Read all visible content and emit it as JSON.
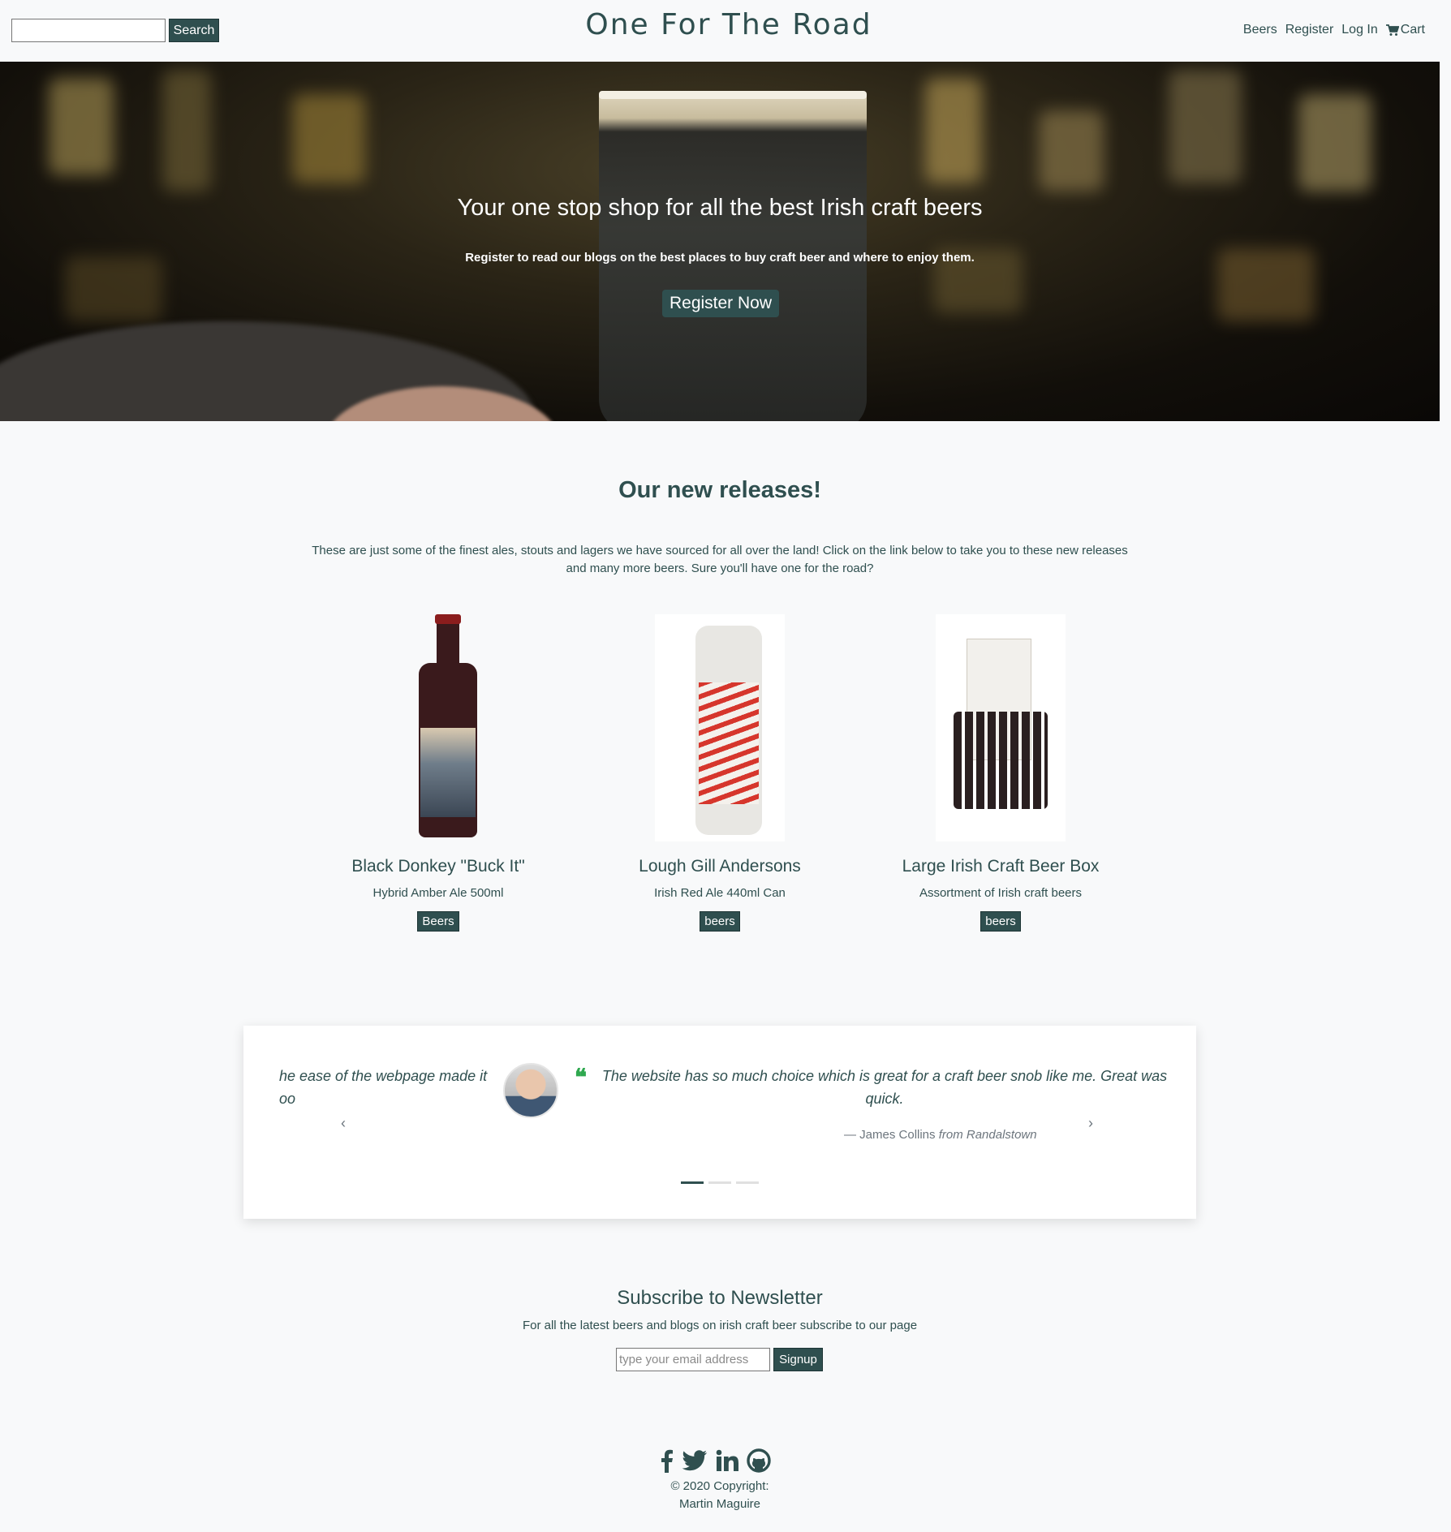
{
  "header": {
    "search_placeholder": "",
    "search_button": "Search",
    "brand": "One For The Road",
    "nav": [
      "Beers",
      "Register",
      "Log In"
    ],
    "cart_label": "Cart",
    "cart_icon": "shopping-cart-icon"
  },
  "hero": {
    "title": "Your one stop shop for all the best Irish craft beers",
    "subtitle": "Register to read our blogs on the best places to buy craft beer and where to enjoy them.",
    "button": "Register Now"
  },
  "new_releases": {
    "title": "Our new releases!",
    "description": "These are just some of the finest ales, stouts and lagers we have sourced for all over the land! Click on the link below to take you to these new releases and many more beers. Sure you'll have one for the road?",
    "products": [
      {
        "name": "Black Donkey \"Buck It\"",
        "desc": "Hybrid Amber Ale 500ml",
        "tag": "Beers"
      },
      {
        "name": "Lough Gill Andersons",
        "desc": "Irish Red Ale 440ml Can",
        "tag": "beers"
      },
      {
        "name": "Large Irish Craft Beer Box",
        "desc": "Assortment of Irish craft beers",
        "tag": "beers"
      }
    ]
  },
  "testimonials": {
    "previous_fragment": "he ease of the webpage made it oo",
    "quote_mark": "❝",
    "text": "The website has so much choice which is great for a craft beer snob like me. Great was quick.",
    "author": "— James Collins",
    "from": "from Randalstown",
    "prev_arrow": "‹",
    "next_arrow": "›",
    "slides": 3,
    "active_slide": 1
  },
  "newsletter": {
    "title": "Subscribe to Newsletter",
    "subtitle": "For all the latest beers and blogs on irish craft beer subscribe to our page",
    "placeholder": "type your email address",
    "button": "Signup"
  },
  "footer": {
    "social_icons": [
      "facebook-icon",
      "twitter-icon",
      "linkedin-icon",
      "github-icon"
    ],
    "copyright_line1": "© 2020 Copyright:",
    "copyright_line2": "Martin Maguire"
  }
}
